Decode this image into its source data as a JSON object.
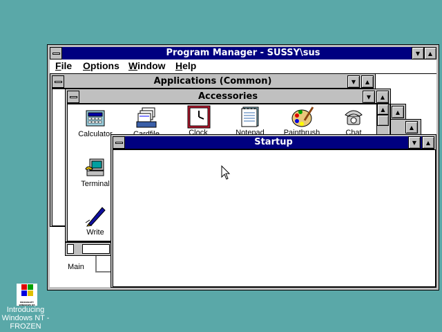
{
  "program_manager": {
    "title": "Program Manager - SUSSY\\sus",
    "menu": [
      "File",
      "Options",
      "Window",
      "Help"
    ]
  },
  "applications_window": {
    "title": "Applications (Common)"
  },
  "accessories_window": {
    "title": "Accessories",
    "icons": [
      "Calculator",
      "Cardfile",
      "Clock",
      "Notepad",
      "Paintbrush",
      "Chat",
      "Terminal",
      "Write"
    ]
  },
  "startup_window": {
    "title": "Startup"
  },
  "main_group": {
    "label": "Main"
  },
  "desktop_icon": {
    "logo_text": "MICROSOFT WINDOWS NT",
    "label_line1": "Introducing",
    "label_line2": "Windows NT -",
    "label_line3": "FROZEN"
  },
  "colors": {
    "desktop": "#5aa8a8",
    "active_title": "#000080",
    "face": "#c0c0c0"
  }
}
